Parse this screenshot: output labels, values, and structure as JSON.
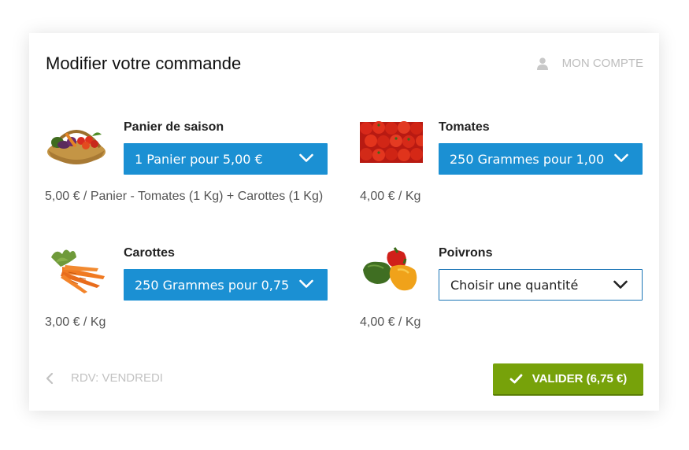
{
  "header": {
    "title": "Modifier votre commande",
    "account_label": "MON COMPTE",
    "account_icon": "user-icon"
  },
  "products": [
    {
      "name": "Panier de saison",
      "selected": "1 Panier pour 5,00 €",
      "price": "5,00 € / Panier - Tomates (1 Kg) + Carottes (1 Kg)",
      "image": "basket-image"
    },
    {
      "name": "Tomates",
      "selected": "250 Grammes pour 1,00",
      "price": "4,00 € / Kg",
      "image": "tomatoes-image"
    },
    {
      "name": "Carottes",
      "selected": "250 Grammes pour 0,75",
      "price": "3,00 € / Kg",
      "image": "carrots-image"
    },
    {
      "name": "Poivrons",
      "selected": "Choisir une quantité",
      "price": "4,00 € / Kg",
      "image": "peppers-image"
    }
  ],
  "footer": {
    "back_label": "RDV: VENDREDI",
    "validate_label": "VALIDER (6,75 €)"
  },
  "colors": {
    "select_blue": "#1b90d3",
    "validate_green": "#77a20a",
    "muted": "#bdbdbd"
  }
}
